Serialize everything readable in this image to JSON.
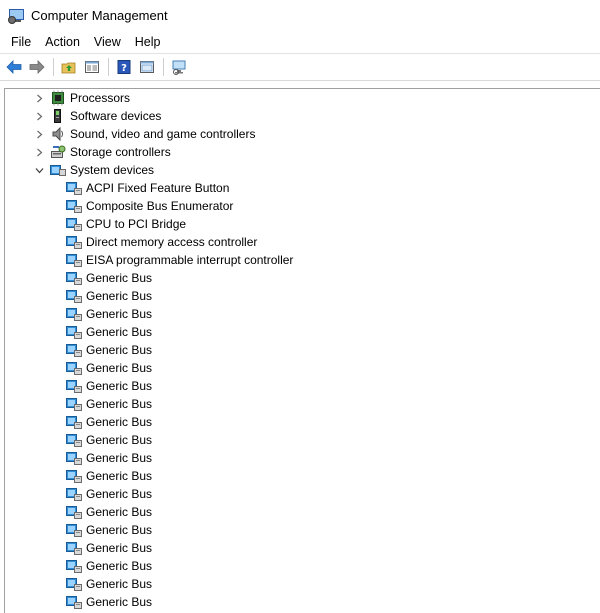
{
  "window": {
    "title": "Computer Management"
  },
  "menu": [
    "File",
    "Action",
    "View",
    "Help"
  ],
  "toolbar": {
    "icons": [
      "back-arrow-icon",
      "forward-arrow-icon",
      "up-folder-icon",
      "show-hide-tree-icon",
      "help-icon",
      "properties-icon",
      "scan-hardware-icon"
    ]
  },
  "tree": {
    "categories": [
      {
        "label": "Processors",
        "icon": "processor-icon"
      },
      {
        "label": "Software devices",
        "icon": "software-device-icon"
      },
      {
        "label": "Sound, video and game controllers",
        "icon": "speaker-icon"
      },
      {
        "label": "Storage controllers",
        "icon": "storage-controller-icon"
      },
      {
        "label": "System devices",
        "icon": "system-device-icon"
      }
    ],
    "system_devices": [
      "ACPI Fixed Feature Button",
      "Composite Bus Enumerator",
      "CPU to PCI Bridge",
      "Direct memory access controller",
      "EISA programmable interrupt controller",
      "Generic Bus",
      "Generic Bus",
      "Generic Bus",
      "Generic Bus",
      "Generic Bus",
      "Generic Bus",
      "Generic Bus",
      "Generic Bus",
      "Generic Bus",
      "Generic Bus",
      "Generic Bus",
      "Generic Bus",
      "Generic Bus",
      "Generic Bus",
      "Generic Bus",
      "Generic Bus",
      "Generic Bus",
      "Generic Bus",
      "Generic Bus"
    ]
  }
}
